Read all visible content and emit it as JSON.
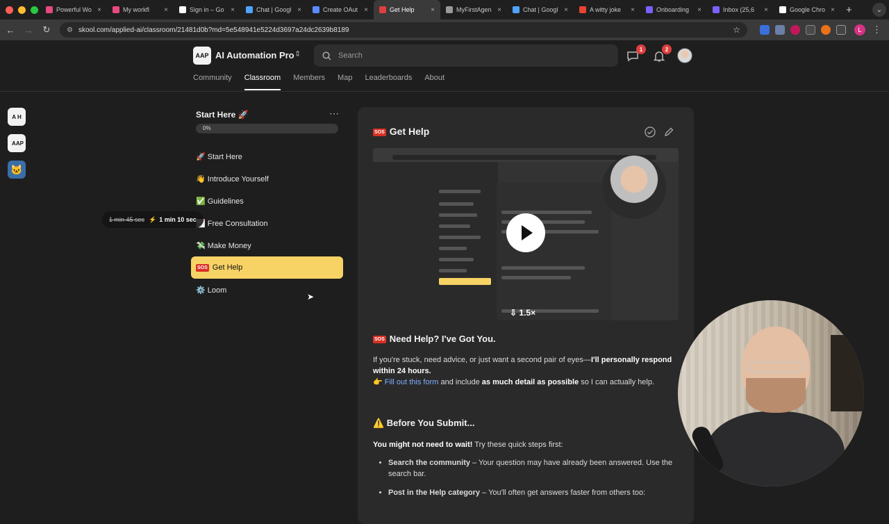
{
  "browser": {
    "tabs": [
      {
        "label": "Powerful Wo",
        "color": "#e84a7f"
      },
      {
        "label": "My workfl",
        "color": "#e84a7f"
      },
      {
        "label": "Sign in – Go",
        "color": "#ffffff"
      },
      {
        "label": "Chat | Googl",
        "color": "#4fa3ff"
      },
      {
        "label": "Create OAut",
        "color": "#5b8cff"
      },
      {
        "label": "Get Help",
        "color": "#e03e3e",
        "active": true
      },
      {
        "label": "MyFirstAgen",
        "color": "#999999"
      },
      {
        "label": "Chat | Googl",
        "color": "#4fa3ff"
      },
      {
        "label": "A witty joke",
        "color": "#ea4335"
      },
      {
        "label": "Onboarding",
        "color": "#7b61ff"
      },
      {
        "label": "Inbox (25,6",
        "color": "#7b61ff"
      },
      {
        "label": "Google Chro",
        "color": "#ffffff"
      }
    ],
    "url": "skool.com/applied-ai/classroom/21481d0b?md=5e548941e5224d3697a24dc2639b8189",
    "profile_initial": "L"
  },
  "header": {
    "logo_text": "AAP",
    "community_name": "AI Automation Pro",
    "search_placeholder": "Search",
    "chat_badge": "1",
    "notif_badge": "2"
  },
  "nav": {
    "community": "Community",
    "classroom": "Classroom",
    "members": "Members",
    "map": "Map",
    "leaderboards": "Leaderboards",
    "about": "About"
  },
  "rail": [
    "A H",
    "AAP",
    "🐱"
  ],
  "module": {
    "title": "Start Here 🚀",
    "progress": "0%",
    "lessons": [
      "🚀 Start Here",
      "👋 Introduce Yourself",
      "✅ Guidelines",
      "📈 Free Consultation",
      "💸 Make Money",
      "Get Help",
      "⚙️ Loom"
    ]
  },
  "lesson": {
    "title": "Get Help",
    "sos": "SOS",
    "video": {
      "speed": "⇩ 1.5×",
      "old_time": "1 min 45 sec",
      "new_time": "1 min 10 sec"
    },
    "section1_title": "Need Help? I've Got You.",
    "p1_start": "If you're stuck, need advice, or just want a second pair of eyes—",
    "p1_bold": "I'll personally respond within 24 hours.",
    "p2_link": "Fill out this form",
    "p2_mid": " and include ",
    "p2_bold": "as much detail as possible",
    "p2_end": " so I can actually help.",
    "section2_title": "⚠️ Before You Submit...",
    "p3_bold": "You might not need to wait!",
    "p3_end": " Try these quick steps first:",
    "tip1_bold": "Search the community",
    "tip1_text": " – Your question may have already been answered. Use the search bar.",
    "tip2_bold": "Post in the Help category",
    "tip2_text": " – You'll often get answers faster from others too:"
  }
}
